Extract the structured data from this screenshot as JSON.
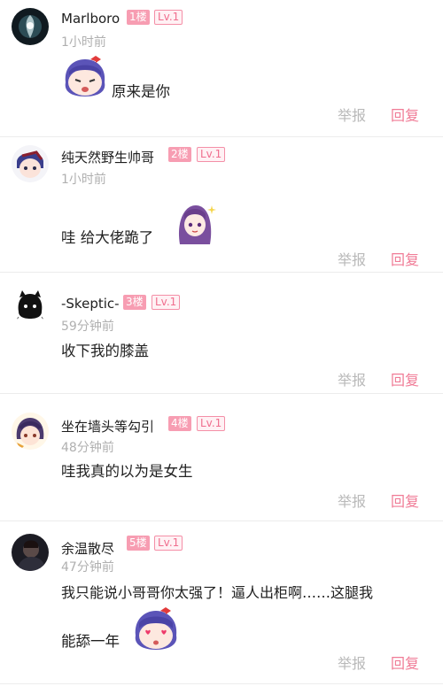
{
  "comments": [
    {
      "username": "Marlboro",
      "floor": "1楼",
      "level": "Lv.1",
      "time": "1小时前",
      "text": "原来是你",
      "report": "举报",
      "reply": "回复",
      "avatar_icon": "smoke-avatar",
      "sticker": "anime-girl-sticker"
    },
    {
      "username": "纯天然野生帅哥",
      "floor": "2楼",
      "level": "Lv.1",
      "time": "1小时前",
      "text": "哇 给大佬跪了",
      "report": "举报",
      "reply": "回复",
      "avatar_icon": "anime-avatar",
      "sticker": "purple-hair-girl-sticker"
    },
    {
      "username": "-Skeptic-",
      "floor": "3楼",
      "level": "Lv.1",
      "time": "59分钟前",
      "text": "收下我的膝盖",
      "report": "举报",
      "reply": "回复",
      "avatar_icon": "black-cat-avatar"
    },
    {
      "username": "坐在墙头等勾引",
      "floor": "4楼",
      "level": "Lv.1",
      "time": "48分钟前",
      "text": "哇我真的以为是女生",
      "report": "举报",
      "reply": "回复",
      "avatar_icon": "anime-girl-avatar"
    },
    {
      "username": "余温散尽",
      "floor": "5楼",
      "level": "Lv.1",
      "time": "47分钟前",
      "text": "我只能说小哥哥你太强了！逼人出柜啊……这腿我",
      "text_line2": "能舔一年",
      "report": "举报",
      "reply": "回复",
      "avatar_icon": "dark-portrait-avatar",
      "sticker": "heart-eyes-girl-sticker"
    }
  ],
  "colors": {
    "accent": "#f07b96",
    "floor_badge": "#f79db2",
    "muted": "#b0b0b0"
  }
}
